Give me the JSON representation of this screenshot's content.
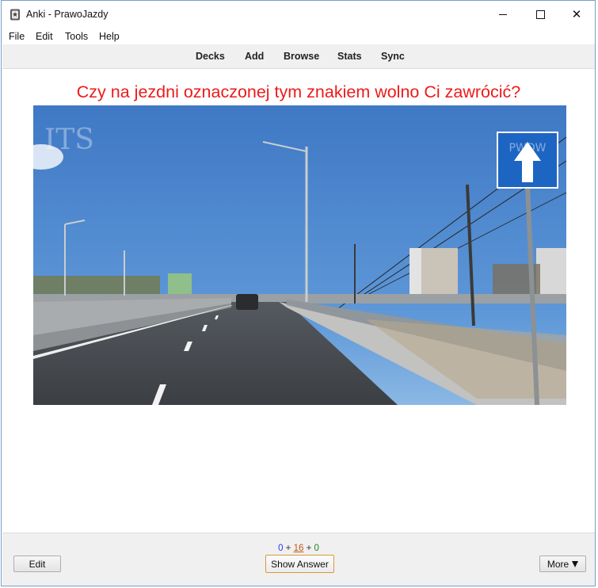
{
  "window": {
    "title": "Anki - PrawoJazdy",
    "controls": {
      "minimize_icon": "minimize-icon",
      "maximize_icon": "maximize-icon",
      "close_icon": "close-icon",
      "close_glyph": "✕"
    }
  },
  "menubar": {
    "items": [
      "File",
      "Edit",
      "Tools",
      "Help"
    ]
  },
  "toolbar": {
    "items": [
      "Decks",
      "Add",
      "Browse",
      "Stats",
      "Sync"
    ]
  },
  "card": {
    "question": "Czy na jezdni oznaczonej tym znakiem wolno Ci zawrócić?",
    "image_description": "Road photo: dual carriageway with a one-way traffic sign (blue square with white upward arrow) on the right",
    "watermark": "ITS",
    "sign_text": "PWDW"
  },
  "counts": {
    "new": "0",
    "learning": "16",
    "review": "0",
    "separator": "+"
  },
  "buttons": {
    "edit": "Edit",
    "show_answer": "Show Answer",
    "more": "More"
  },
  "colors": {
    "question": "#ee1a1a",
    "new": "#3333ff",
    "learning": "#c35617",
    "review": "#1a8a1a",
    "show_answer_border": "#d89a3a"
  }
}
